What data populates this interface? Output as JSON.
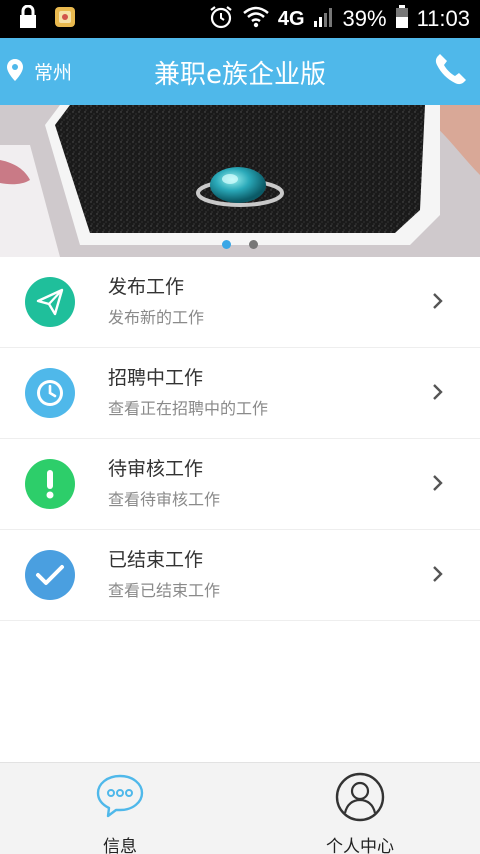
{
  "status_bar": {
    "network": "4G",
    "battery": "39%",
    "time": "11:03"
  },
  "header": {
    "location": "常州",
    "title": "兼职e族企业版"
  },
  "banner": {
    "slide_count": 2,
    "active_slide": 1
  },
  "menu": [
    {
      "title": "发布工作",
      "subtitle": "发布新的工作",
      "icon": "send-icon",
      "color": "#1fbf9b"
    },
    {
      "title": "招聘中工作",
      "subtitle": "查看正在招聘中的工作",
      "icon": "clock-icon",
      "color": "#4fb8ea"
    },
    {
      "title": "待审核工作",
      "subtitle": "查看待审核工作",
      "icon": "alert-icon",
      "color": "#2dce6a"
    },
    {
      "title": "已结束工作",
      "subtitle": "查看已结束工作",
      "icon": "check-icon",
      "color": "#4a9fe0"
    }
  ],
  "bottom_nav": {
    "messages_label": "信息",
    "profile_label": "个人中心"
  }
}
